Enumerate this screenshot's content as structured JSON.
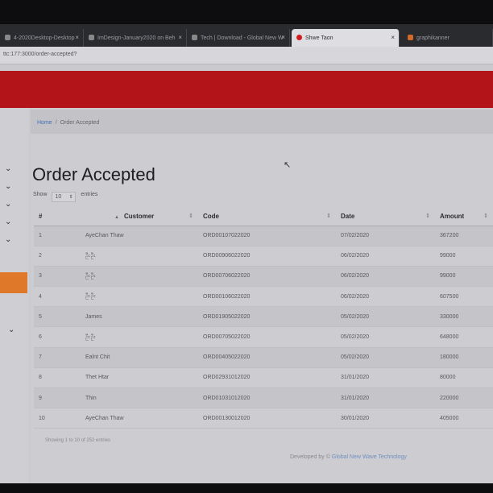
{
  "browser": {
    "tabs": [
      {
        "label": "4-2020Desktop-Desktop",
        "active": false
      },
      {
        "label": "ImDesign-January2020 on Beh",
        "active": false
      },
      {
        "label": "Tech | Download - Global New W",
        "active": false
      },
      {
        "label": "Shwe Taon",
        "active": true
      },
      {
        "label": "graphikanner",
        "active": false
      }
    ],
    "url": "ttc:177:3000/order-accepted?"
  },
  "breadcrumb": {
    "home": "Home",
    "separator": "/",
    "current": "Order Accepted"
  },
  "page": {
    "title": "Order Accepted",
    "show_label": "Show",
    "entries_value": "10",
    "entries_label": "entries"
  },
  "table": {
    "columns": [
      "#",
      "Customer",
      "Code",
      "Date",
      "Amount"
    ],
    "rows": [
      {
        "num": "1",
        "customer": "AyeChan Thaw",
        "code": "ORD00107022020",
        "date": "07/02/2020",
        "amount": "367200"
      },
      {
        "num": "2",
        "customer": "ဦးဦး",
        "code": "ORD00906022020",
        "date": "06/02/2020",
        "amount": "99000"
      },
      {
        "num": "3",
        "customer": "ဦးဦး",
        "code": "ORD00706022020",
        "date": "06/02/2020",
        "amount": "99000"
      },
      {
        "num": "4",
        "customer": "ဦးဦး",
        "code": "ORD00106022020",
        "date": "06/02/2020",
        "amount": "607500"
      },
      {
        "num": "5",
        "customer": "James",
        "code": "ORD01905022020",
        "date": "05/02/2020",
        "amount": "330000"
      },
      {
        "num": "6",
        "customer": "ဦးဦး",
        "code": "ORD00705022020",
        "date": "05/02/2020",
        "amount": "648000"
      },
      {
        "num": "7",
        "customer": "Ealnt Chit",
        "code": "ORD00405022020",
        "date": "05/02/2020",
        "amount": "180000"
      },
      {
        "num": "8",
        "customer": "Thet Htar",
        "code": "ORD02931012020",
        "date": "31/01/2020",
        "amount": "80000"
      },
      {
        "num": "9",
        "customer": "Thin",
        "code": "ORD01031012020",
        "date": "31/01/2020",
        "amount": "220000"
      },
      {
        "num": "10",
        "customer": "AyeChan Thaw",
        "code": "ORD00130012020",
        "date": "30/01/2020",
        "amount": "405000"
      }
    ]
  },
  "table_info": "Showing 1 to 10 of 252 entries",
  "footer": {
    "prefix": "Developed by ©",
    "link": "Global New Wave Technology"
  },
  "colors": {
    "header_red": "#b2141a",
    "sidebar_active": "#e0782a",
    "link_blue": "#3f6fb8"
  },
  "taskbar": {
    "buttons": [
      "start-icon",
      "folder-icon",
      "media-icon",
      "app-icon",
      "chrome-icon",
      "pin-icon",
      "app-icon",
      "app-icon",
      "app-icon"
    ]
  }
}
